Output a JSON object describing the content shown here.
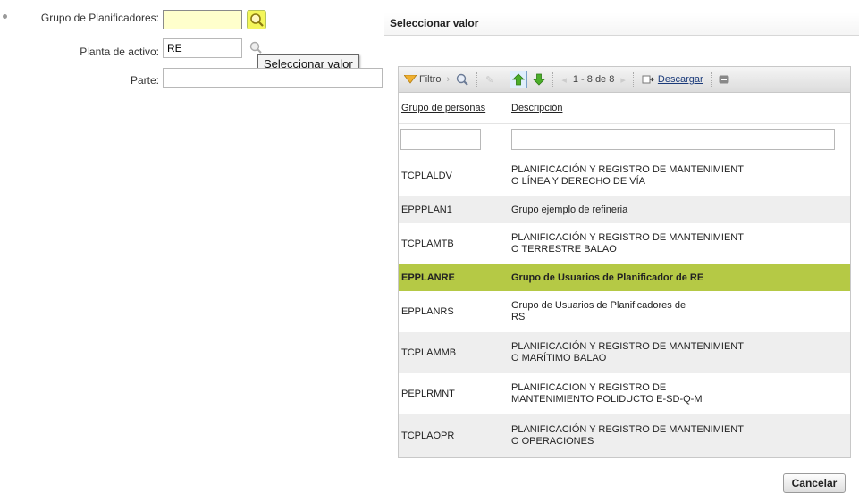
{
  "form": {
    "fields": [
      {
        "label": "Grupo de Planificadores:",
        "value": "",
        "required": true
      },
      {
        "label": "Planta de activo:",
        "value": "RE"
      },
      {
        "label": "Parte:",
        "value": ""
      }
    ],
    "tooltip": "Seleccionar valor"
  },
  "dialog": {
    "title": "Seleccionar valor",
    "toolbar": {
      "filter_label": "Filtro",
      "paging": "1 - 8 de 8",
      "download_label": "Descargar"
    },
    "columns": [
      "Grupo de personas",
      "Descripción"
    ],
    "rows": [
      {
        "code": "TCPLALDV",
        "desc1": "PLANIFICACIÓN Y REGISTRO DE MANTENIMIENT",
        "desc2": "O LÍNEA Y DERECHO DE VÍA"
      },
      {
        "code": "EPPPLAN1",
        "desc1": "Grupo ejemplo de refineria",
        "desc2": ""
      },
      {
        "code": "TCPLAMTB",
        "desc1": "PLANIFICACIÓN Y REGISTRO DE MANTENIMIENT",
        "desc2": "O TERRESTRE BALAO"
      },
      {
        "code": "EPPLANRE",
        "desc1": "Grupo de Usuarios de Planificador de RE",
        "desc2": ""
      },
      {
        "code": "EPPLANRS",
        "desc1": "Grupo de Usuarios de Planificadores de",
        "desc2": "RS"
      },
      {
        "code": "TCPLAMMB",
        "desc1": "PLANIFICACIÓN Y REGISTRO DE MANTENIMIENT",
        "desc2": "O MARÍTIMO BALAO"
      },
      {
        "code": "PEPLRMNT",
        "desc1": "PLANIFICACION Y REGISTRO DE",
        "desc2": "MANTENIMIENTO POLIDUCTO E-SD-Q-M"
      },
      {
        "code": "TCPLAOPR",
        "desc1": "PLANIFICACIÓN Y REGISTRO DE MANTENIMIENT",
        "desc2": "O OPERACIONES"
      }
    ],
    "selected_index": 3,
    "cancel_label": "Cancelar"
  },
  "colors": {
    "selected_row": "#b5c945",
    "active_input": "#ffffcc",
    "lookup_button": "#f4f65a"
  },
  "icons": [
    "magnifier-icon",
    "filter-icon",
    "arrow-up-icon",
    "arrow-down-icon",
    "download-icon"
  ]
}
